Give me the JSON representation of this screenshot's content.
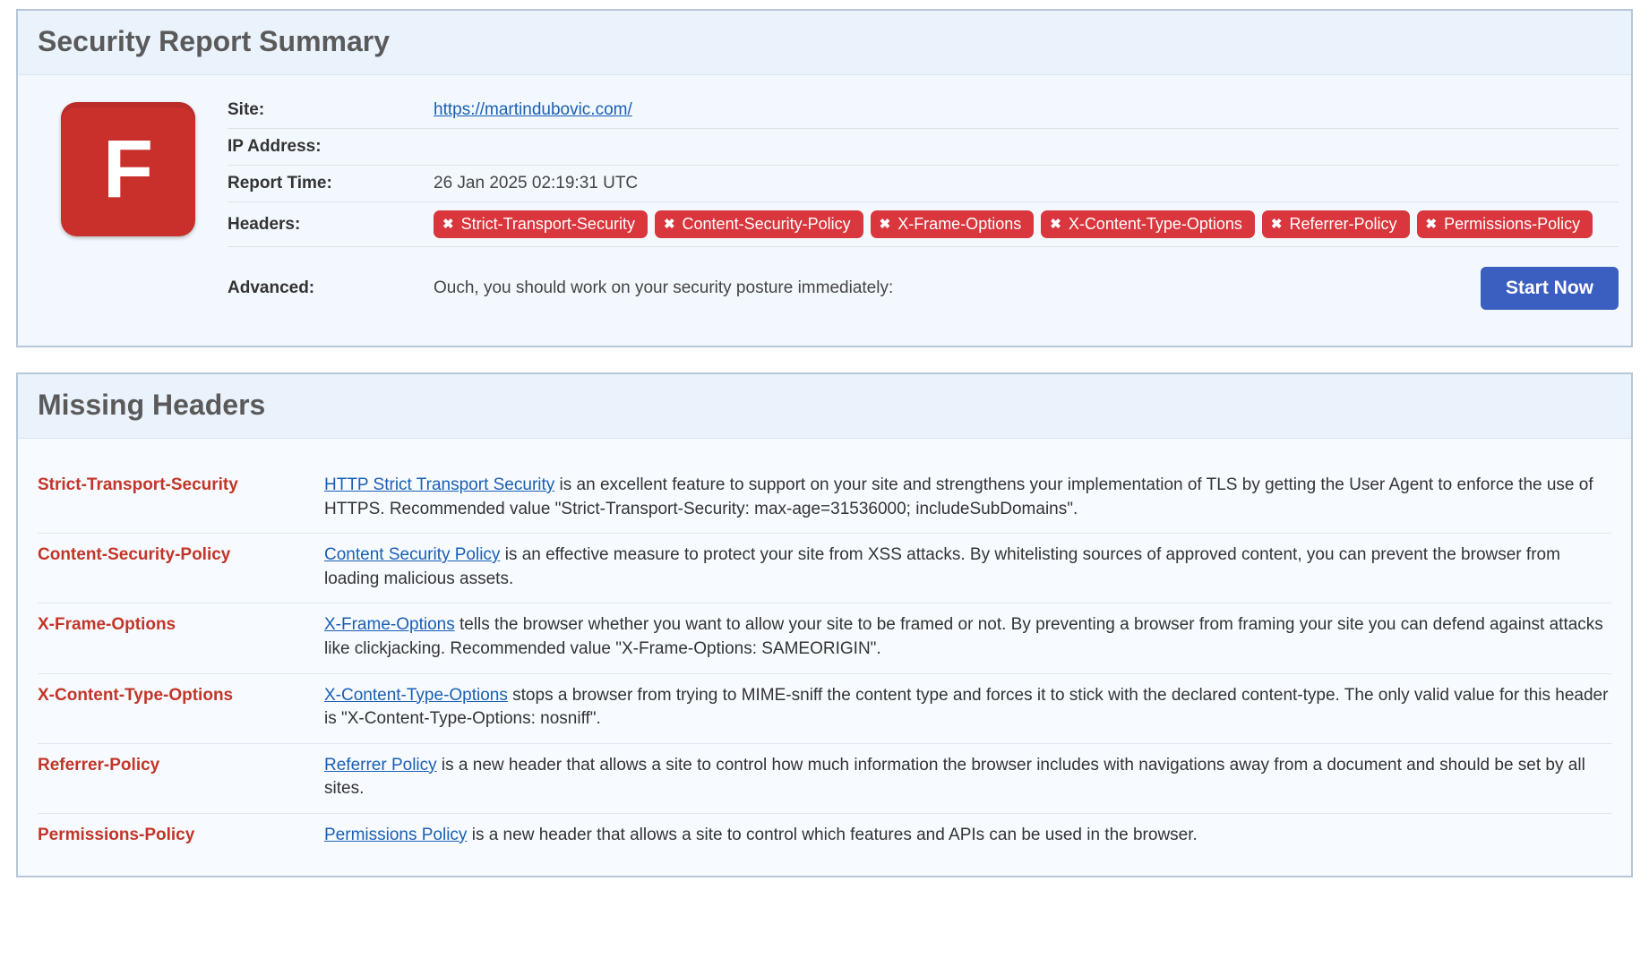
{
  "summary": {
    "title": "Security Report Summary",
    "grade": "F",
    "site_label": "Site:",
    "site_url": "https://martindubovic.com/",
    "ip_label": "IP Address:",
    "ip_value": "",
    "time_label": "Report Time:",
    "time_value": "26 Jan 2025 02:19:31 UTC",
    "headers_label": "Headers:",
    "header_pills": [
      "Strict-Transport-Security",
      "Content-Security-Policy",
      "X-Frame-Options",
      "X-Content-Type-Options",
      "Referrer-Policy",
      "Permissions-Policy"
    ],
    "advanced_label": "Advanced:",
    "advanced_msg": "Ouch, you should work on your security posture immediately:",
    "start_button": "Start Now"
  },
  "missing": {
    "title": "Missing Headers",
    "items": [
      {
        "name": "Strict-Transport-Security",
        "link_text": "HTTP Strict Transport Security",
        "desc_tail": " is an excellent feature to support on your site and strengthens your implementation of TLS by getting the User Agent to enforce the use of HTTPS. Recommended value \"Strict-Transport-Security: max-age=31536000; includeSubDomains\"."
      },
      {
        "name": "Content-Security-Policy",
        "link_text": "Content Security Policy",
        "desc_tail": " is an effective measure to protect your site from XSS attacks. By whitelisting sources of approved content, you can prevent the browser from loading malicious assets."
      },
      {
        "name": "X-Frame-Options",
        "link_text": "X-Frame-Options",
        "desc_tail": " tells the browser whether you want to allow your site to be framed or not. By preventing a browser from framing your site you can defend against attacks like clickjacking. Recommended value \"X-Frame-Options: SAMEORIGIN\"."
      },
      {
        "name": "X-Content-Type-Options",
        "link_text": "X-Content-Type-Options",
        "desc_tail": " stops a browser from trying to MIME-sniff the content type and forces it to stick with the declared content-type. The only valid value for this header is \"X-Content-Type-Options: nosniff\"."
      },
      {
        "name": "Referrer-Policy",
        "link_text": "Referrer Policy",
        "desc_tail": " is a new header that allows a site to control how much information the browser includes with navigations away from a document and should be set by all sites."
      },
      {
        "name": "Permissions-Policy",
        "link_text": "Permissions Policy",
        "desc_tail": " is a new header that allows a site to control which features and APIs can be used in the browser."
      }
    ]
  }
}
